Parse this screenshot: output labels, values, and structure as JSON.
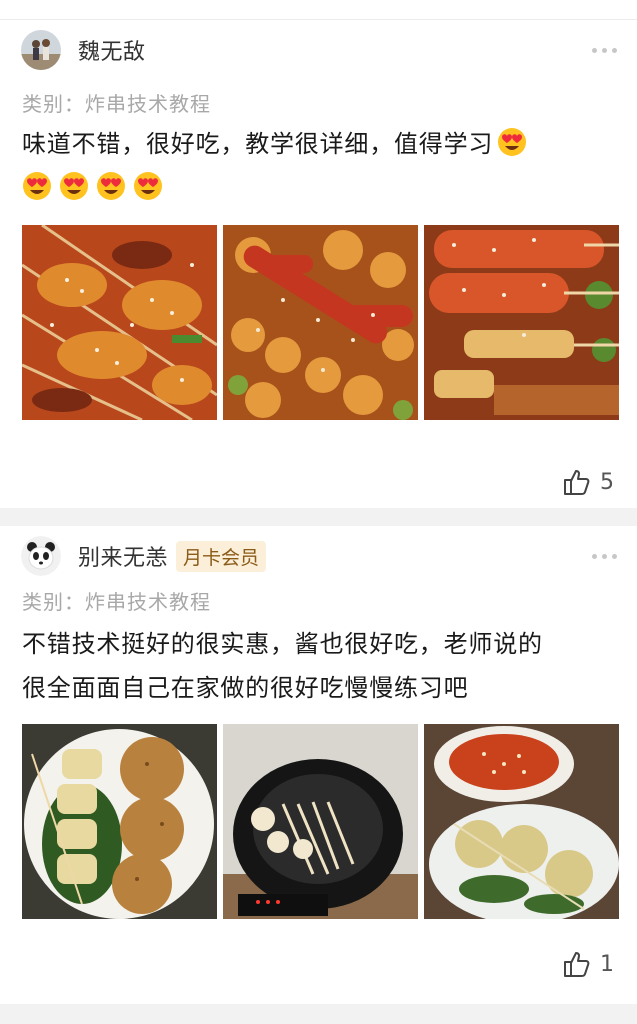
{
  "posts": [
    {
      "username": "魏无敌",
      "category": "类别：炸串技术教程",
      "text": "味道不错，很好吃，教学很详细，值得学习",
      "emoji_count": 5,
      "likes": "5",
      "photos": [
        "fried-skewers-spicy",
        "sausage-and-fishballs",
        "chili-sausage-skewers"
      ]
    },
    {
      "username": "别来无恙",
      "badge": "月卡会员",
      "category": "类别：炸串技术教程",
      "text_line1": "不错技术挺好的很实惠，酱也很好吃，老师说的",
      "text_line2": "很全面面自己在家做的很好吃慢慢练习吧",
      "likes": "1",
      "photos": [
        "tofu-skewers-plate",
        "frying-pan-skewers",
        "sauce-bowl-and-skewers"
      ]
    }
  ],
  "icons": {
    "more": "more-dots-icon",
    "like": "thumbs-up-icon",
    "emoji": "heart-eyes-emoji"
  }
}
